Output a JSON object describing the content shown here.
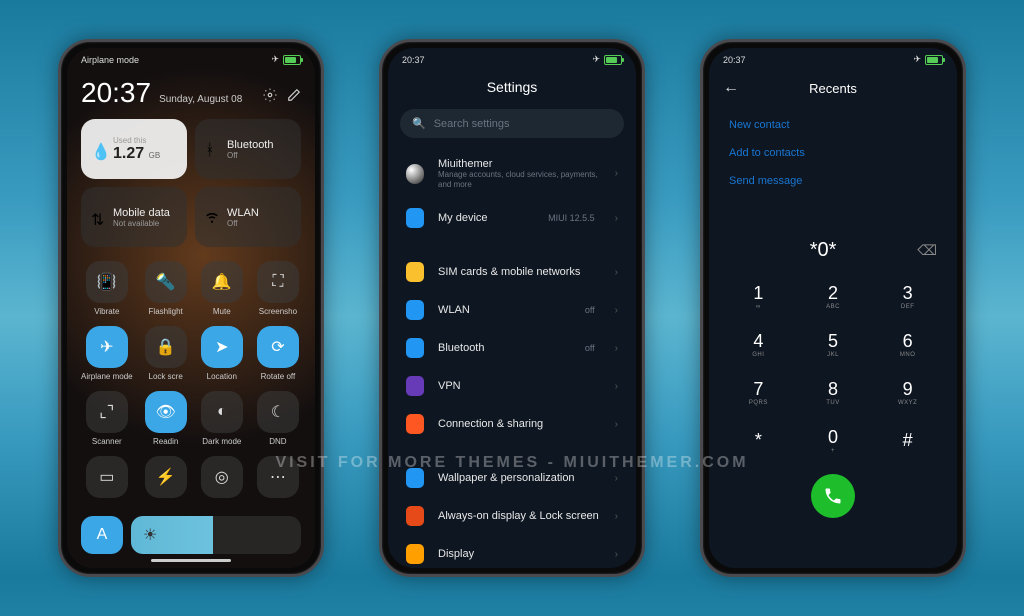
{
  "watermark": "visit for more themes - miuithemer.com",
  "status": {
    "time": "20:37",
    "airplane_label": "Airplane mode"
  },
  "cc": {
    "time": "20:37",
    "date": "Sunday, August 08",
    "usage_label": "Used this",
    "usage_value": "1.27",
    "usage_unit": "GB",
    "bluetooth": "Bluetooth",
    "bluetooth_state": "Off",
    "mobile_data": "Mobile data",
    "mobile_data_state": "Not available",
    "wlan": "WLAN",
    "wlan_state": "Off",
    "tiles": [
      {
        "label": "Vibrate",
        "icon": "vibrate-icon",
        "on": false
      },
      {
        "label": "Flashlight",
        "icon": "flashlight-icon",
        "on": false
      },
      {
        "label": "Mute",
        "icon": "bell-icon",
        "on": false
      },
      {
        "label": "Screensho",
        "icon": "screenshot-icon",
        "on": false
      },
      {
        "label": "Airplane mode",
        "icon": "airplane-icon",
        "on": true
      },
      {
        "label": "Lock scre",
        "icon": "lock-icon",
        "on": false
      },
      {
        "label": "Location",
        "icon": "location-icon",
        "on": true
      },
      {
        "label": "Rotate off",
        "icon": "rotate-icon",
        "on": true
      },
      {
        "label": "Scanner",
        "icon": "scanner-icon",
        "on": false
      },
      {
        "label": "Readin",
        "icon": "reading-icon",
        "on": true
      },
      {
        "label": "Dark mode",
        "icon": "darkmode-icon",
        "on": false
      },
      {
        "label": "DND",
        "icon": "dnd-icon",
        "on": false
      },
      {
        "label": "",
        "icon": "battery-icon",
        "on": false
      },
      {
        "label": "",
        "icon": "flash-icon",
        "on": false
      },
      {
        "label": "",
        "icon": "hotspot-icon",
        "on": false
      },
      {
        "label": "",
        "icon": "dots-icon",
        "on": false
      }
    ],
    "auto_brightness": "A"
  },
  "settings": {
    "title": "Settings",
    "search_placeholder": "Search settings",
    "account": {
      "name": "Miuithemer",
      "sub": "Manage accounts, cloud services, payments, and more"
    },
    "items": [
      {
        "icon": "device-icon",
        "label": "My device",
        "value": "MIUI 12.5.5",
        "color": "#2196f3"
      },
      {
        "gap": true
      },
      {
        "icon": "sim-icon",
        "label": "SIM cards & mobile networks",
        "value": "",
        "color": "#fbc02d"
      },
      {
        "icon": "wifi-icon",
        "label": "WLAN",
        "value": "off",
        "color": "#2196f3"
      },
      {
        "icon": "bluetooth-icon",
        "label": "Bluetooth",
        "value": "off",
        "color": "#2196f3"
      },
      {
        "icon": "vpn-icon",
        "label": "VPN",
        "value": "",
        "color": "#673ab7"
      },
      {
        "icon": "share-icon",
        "label": "Connection & sharing",
        "value": "",
        "color": "#ff5722"
      },
      {
        "gap": true
      },
      {
        "icon": "wallpaper-icon",
        "label": "Wallpaper & personalization",
        "value": "",
        "color": "#2196f3"
      },
      {
        "icon": "aod-icon",
        "label": "Always-on display & Lock screen",
        "value": "",
        "color": "#e64a19"
      },
      {
        "icon": "display-icon",
        "label": "Display",
        "value": "",
        "color": "#ffa000"
      }
    ]
  },
  "dialer": {
    "title": "Recents",
    "links": [
      "New contact",
      "Add to contacts",
      "Send message"
    ],
    "number": "*0*",
    "keys": [
      {
        "num": "1",
        "sub": "∞"
      },
      {
        "num": "2",
        "sub": "ABC"
      },
      {
        "num": "3",
        "sub": "DEF"
      },
      {
        "num": "4",
        "sub": "GHI"
      },
      {
        "num": "5",
        "sub": "JKL"
      },
      {
        "num": "6",
        "sub": "MNO"
      },
      {
        "num": "7",
        "sub": "PQRS"
      },
      {
        "num": "8",
        "sub": "TUV"
      },
      {
        "num": "9",
        "sub": "WXYZ"
      },
      {
        "num": "*",
        "sub": ""
      },
      {
        "num": "0",
        "sub": "+"
      },
      {
        "num": "#",
        "sub": ""
      }
    ]
  }
}
